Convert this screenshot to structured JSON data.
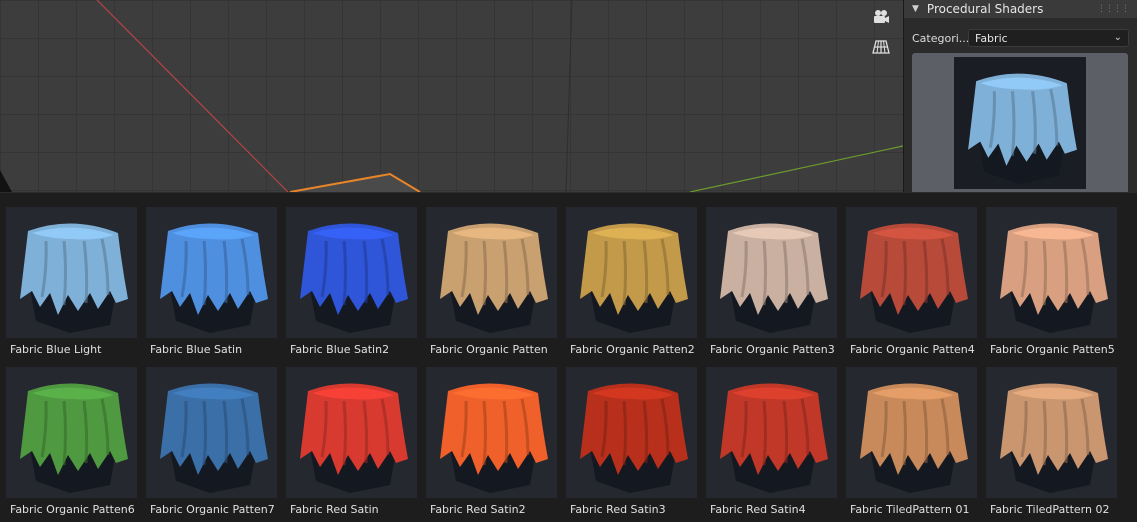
{
  "panel": {
    "title": "Procedural Shaders",
    "category_label": "Categori...",
    "category_value": "Fabric"
  },
  "viewport": {
    "icons": [
      "camera-view-icon",
      "grid-view-icon"
    ]
  },
  "materials": [
    {
      "label": "Fabric Blue Light",
      "color": "#7fb0d8"
    },
    {
      "label": "Fabric Blue Satin",
      "color": "#4f8fe0"
    },
    {
      "label": "Fabric Blue Satin2",
      "color": "#2f55d8"
    },
    {
      "label": "Fabric Organic Patten",
      "color": "#c9a070"
    },
    {
      "label": "Fabric Organic Patten2",
      "color": "#c29a4a"
    },
    {
      "label": "Fabric Organic Patten3",
      "color": "#c9b0a0"
    },
    {
      "label": "Fabric Organic Patten4",
      "color": "#b84a3a"
    },
    {
      "label": "Fabric Organic Patten5",
      "color": "#d8a080"
    },
    {
      "label": "Fabric Organic Patten6",
      "color": "#4f9a40"
    },
    {
      "label": "Fabric Organic Patten7",
      "color": "#3a6fa8"
    },
    {
      "label": "Fabric Red Satin",
      "color": "#d83a30"
    },
    {
      "label": "Fabric Red Satin2",
      "color": "#f0602a"
    },
    {
      "label": "Fabric Red Satin3",
      "color": "#b8301c"
    },
    {
      "label": "Fabric Red Satin4",
      "color": "#c23828"
    },
    {
      "label": "Fabric TiledPattern 01",
      "color": "#c88a5a"
    },
    {
      "label": "Fabric TiledPattern 02",
      "color": "#c99670"
    }
  ]
}
